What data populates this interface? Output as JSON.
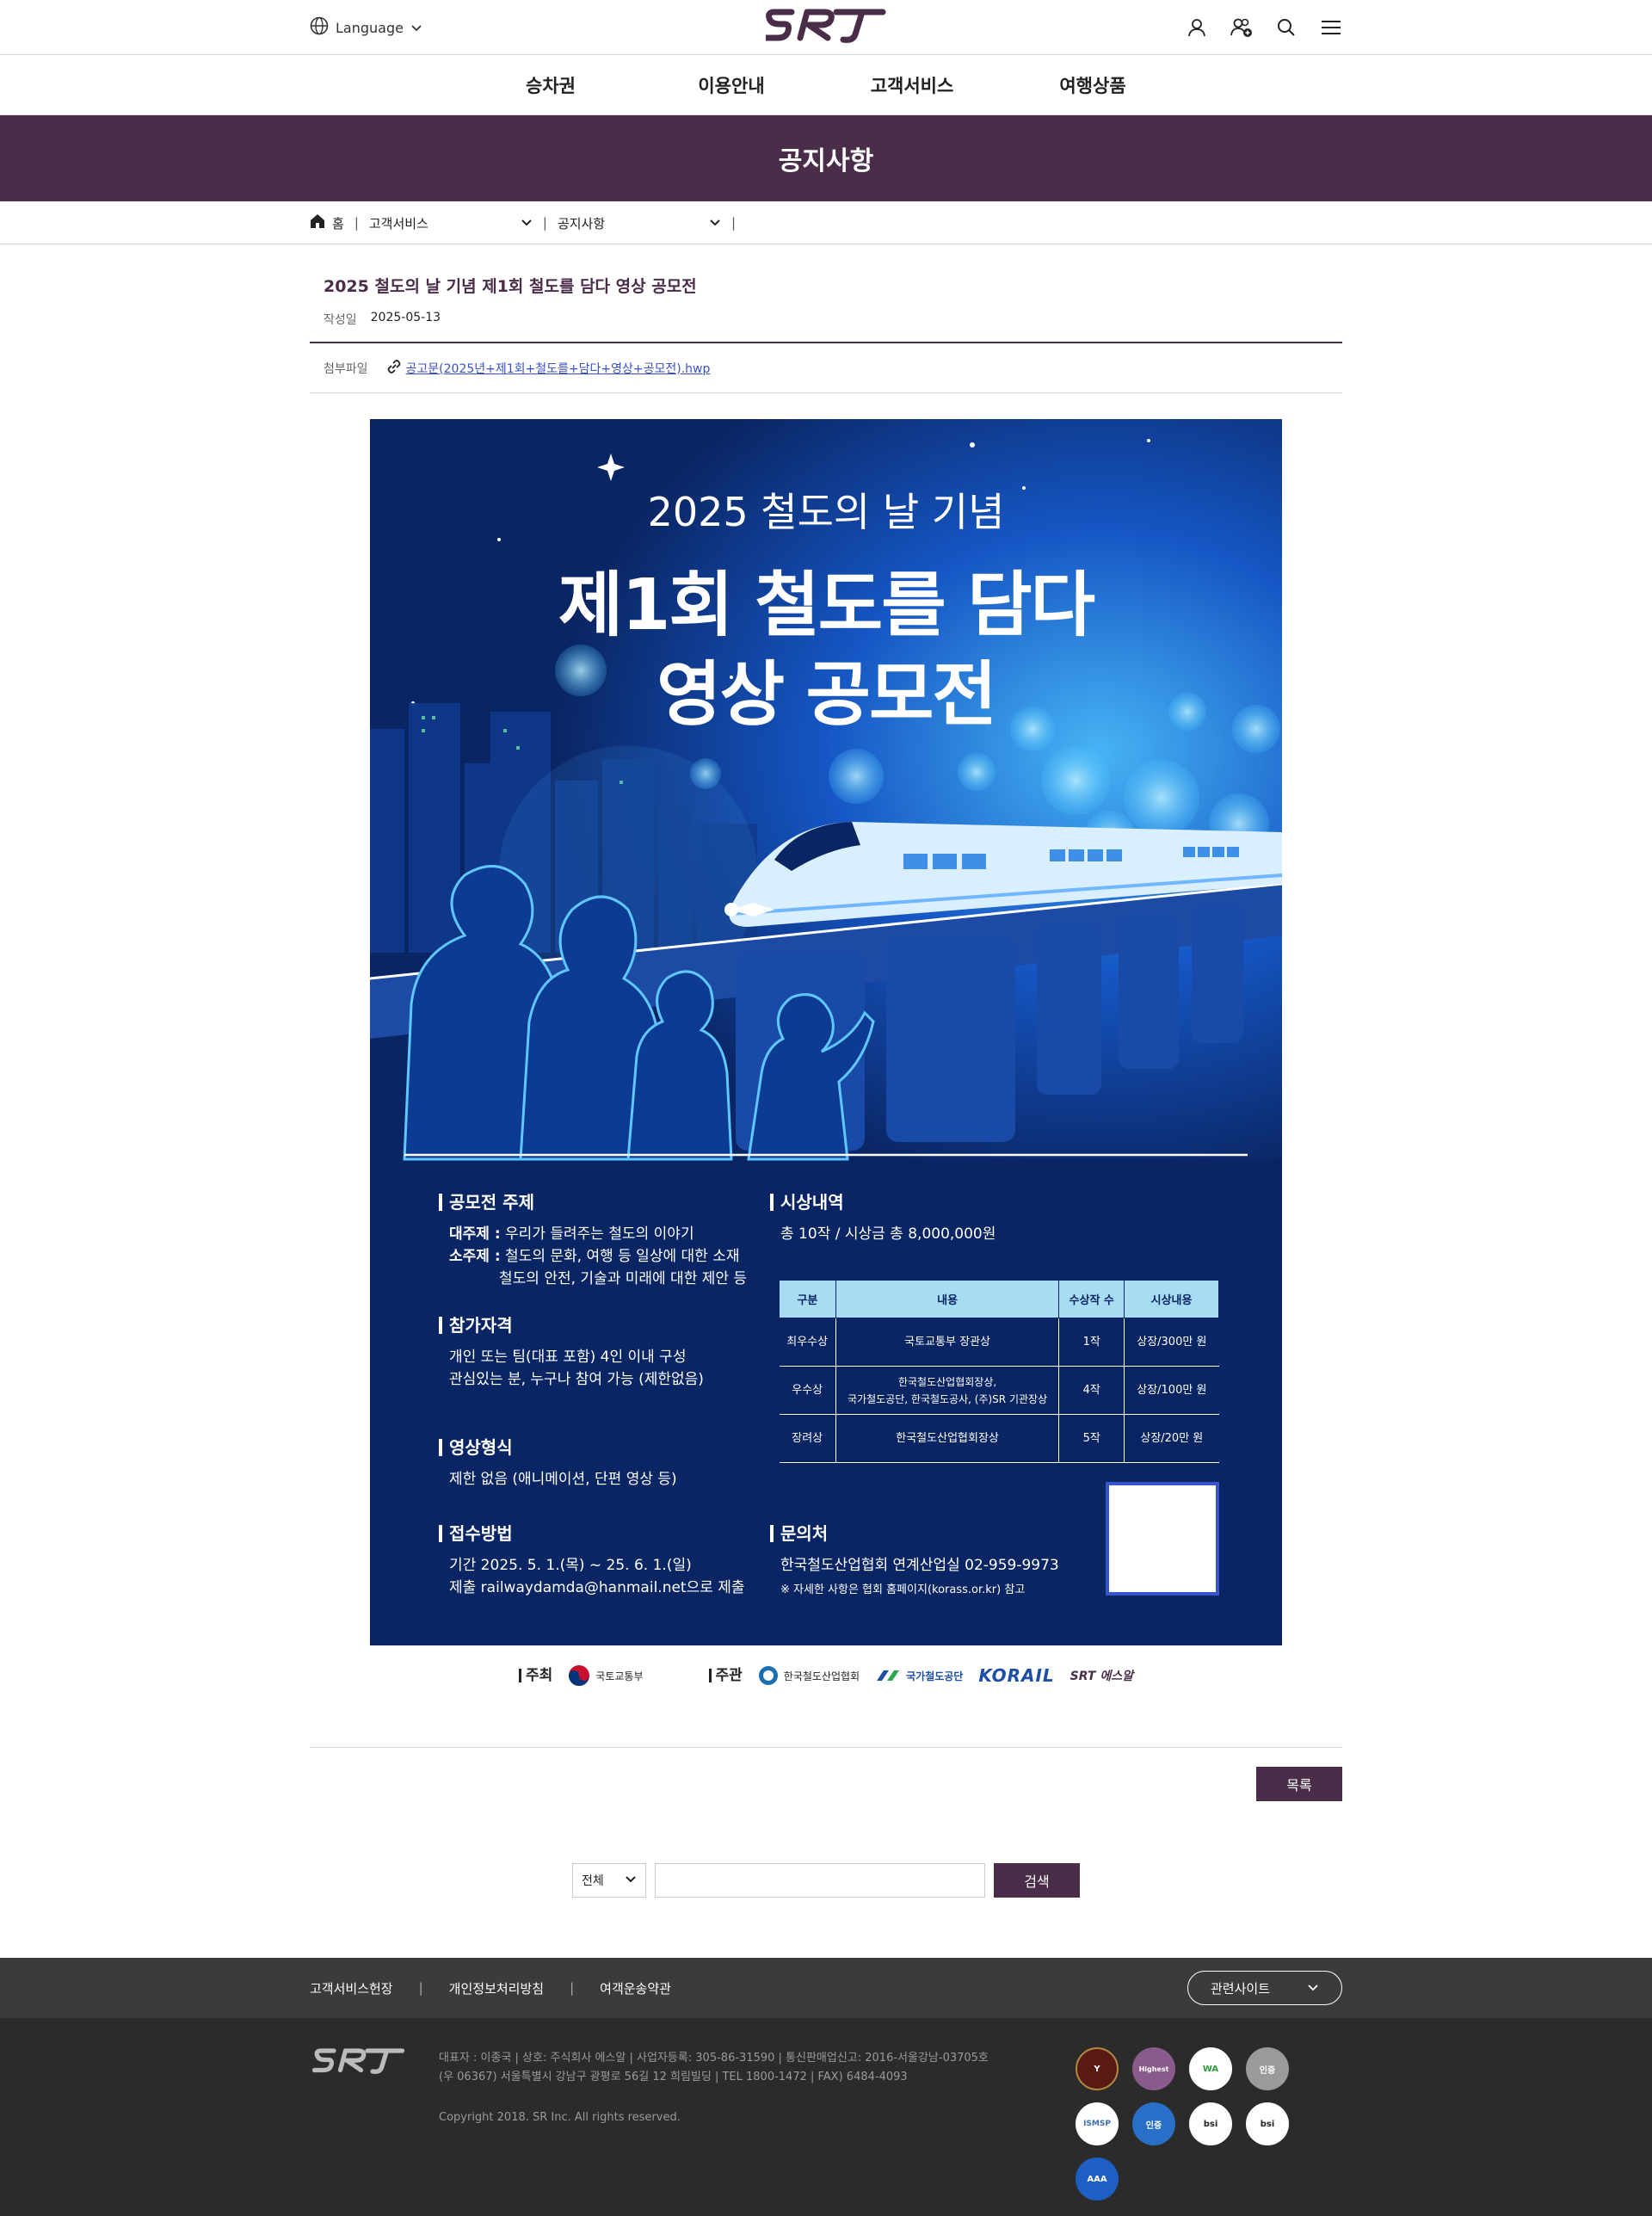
{
  "header": {
    "language_label": "Language",
    "logo_text": "SRT"
  },
  "gnb": {
    "items": [
      "승차권",
      "이용안내",
      "고객서비스",
      "여행상품"
    ]
  },
  "page_title": "공지사항",
  "breadcrumb": {
    "home": "홈",
    "level1": "고객서비스",
    "level2": "공지사항"
  },
  "article": {
    "title": "2025 철도의 날 기념 제1회 철도를 담다 영상 공모전",
    "date_label": "작성일",
    "date": "2025-05-13",
    "attach_label": "첨부파일",
    "attach_file": "공고문(2025년+제1회+철도를+담다+영상+공모전).hwp"
  },
  "poster": {
    "subtitle": "2025 철도의 날 기념",
    "main_line1": "제1회 철도를 담다",
    "main_line2": "영상 공모전",
    "theme": {
      "head": "공모전 주제",
      "main_label": "대주제 :",
      "main_text": "우리가 들려주는 철도의 이야기",
      "sub_label": "소주제 :",
      "sub_text1": "철도의 문화, 여행 등 일상에 대한 소재",
      "sub_text2": "철도의 안전, 기술과 미래에 대한 제안 등"
    },
    "eligibility": {
      "head": "참가자격",
      "line1": "개인 또는 팀(대표 포함) 4인 이내 구성",
      "line2": "관심있는 분, 누구나 참여 가능 (제한없음)"
    },
    "format": {
      "head": "영상형식",
      "line1": "제한 없음 (애니메이션, 단편 영상 등)"
    },
    "submit": {
      "head": "접수방법",
      "line1": "기간 2025. 5. 1.(목) ~ 25. 6. 1.(일)",
      "line2": "제출 railwaydamda@hanmail.net으로 제출"
    },
    "awards": {
      "head": "시상내역",
      "summary": "총 10작 / 시상금 총 8,000,000원",
      "columns": [
        "구분",
        "내용",
        "수상작 수",
        "시상내용"
      ],
      "rows": [
        [
          "최우수상",
          "국토교통부 장관상",
          "1작",
          "상장/300만 원"
        ],
        [
          "우수상",
          "한국철도산업협회장상,\n국가철도공단, 한국철도공사, (주)SR 기관장상",
          "4작",
          "상장/100만 원"
        ],
        [
          "장려상",
          "한국철도산업협회장상",
          "5작",
          "상장/20만 원"
        ]
      ]
    },
    "contact": {
      "head": "문의처",
      "line1": "한국철도산업협회 연계산업실 02-959-9973",
      "note": "※ 자세한 사항은 협회 홈페이지(korass.or.kr) 참고"
    }
  },
  "sponsors": {
    "host_label": "주최",
    "host": "국토교통부",
    "organizer_label": "주관",
    "org1": "한국철도산업협회",
    "org2": "국가철도공단",
    "org3": "KORAIL",
    "org4": "SRT 에스알"
  },
  "buttons": {
    "list": "목록",
    "search": "검색"
  },
  "search": {
    "select_value": "전체",
    "placeholder": ""
  },
  "footer": {
    "links": [
      "고객서비스헌장",
      "개인정보처리방침",
      "여객운송약관"
    ],
    "related": "관련사이트",
    "info1": "대표자 : 이종국 | 상호: 주식회사 에스알 | 사업자등록: 305-86-31590 | 통신판매업신고: 2016-서울강남-03705호",
    "info2": "(우 06367) 서울특별시 강남구 광평로 56길 12 희림빌딩 | TEL 1800-1472 | FAX) 6484-4093",
    "copyright": "Copyright 2018. SR Inc. All rights reserved.",
    "cert_labels": [
      "Y",
      "Highest",
      "WA",
      "인증",
      "ISMSP",
      "인증",
      "bsi",
      "bsi",
      "AAA"
    ]
  },
  "colors": {
    "brand": "#4a2d49",
    "poster_bg": "#0a2563",
    "table_head": "#a7dcf3"
  }
}
